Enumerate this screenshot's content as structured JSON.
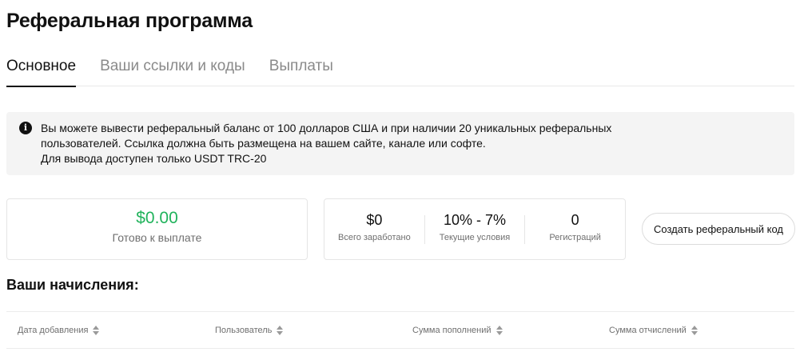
{
  "page": {
    "title": "Реферальная программа"
  },
  "tabs": [
    {
      "label": "Основное",
      "active": true
    },
    {
      "label": "Ваши ссылки и коды",
      "active": false
    },
    {
      "label": "Выплаты",
      "active": false
    }
  ],
  "notice": {
    "icon": "info-icon",
    "lines": [
      "Вы можете вывести реферальный баланс от 100 долларов США и при наличии 20 уникальных реферальных",
      "пользователей. Ссылка должна быть размещена на вашем сайте, канале или софте.",
      "Для вывода доступен только USDT TRC-20"
    ]
  },
  "balance": {
    "amount": "$0.00",
    "label": "Готово к выплате",
    "amount_color": "#21b35c"
  },
  "stats": [
    {
      "value": "$0",
      "label": "Всего заработано"
    },
    {
      "value": "10% - 7%",
      "label": "Текущие условия"
    },
    {
      "value": "0",
      "label": "Регистраций"
    }
  ],
  "create_button": {
    "label": "Создать реферальный код"
  },
  "accruals": {
    "title": "Ваши начисления:",
    "columns": [
      {
        "label": "Дата добавления",
        "sort_icon": "sort-icon"
      },
      {
        "label": "Пользователь",
        "sort_icon": "sort-icon"
      },
      {
        "label": "Сумма пополнений",
        "sort_icon": "sort-icon"
      },
      {
        "label": "Сумма отчислений",
        "sort_icon": "sort-icon"
      }
    ]
  }
}
